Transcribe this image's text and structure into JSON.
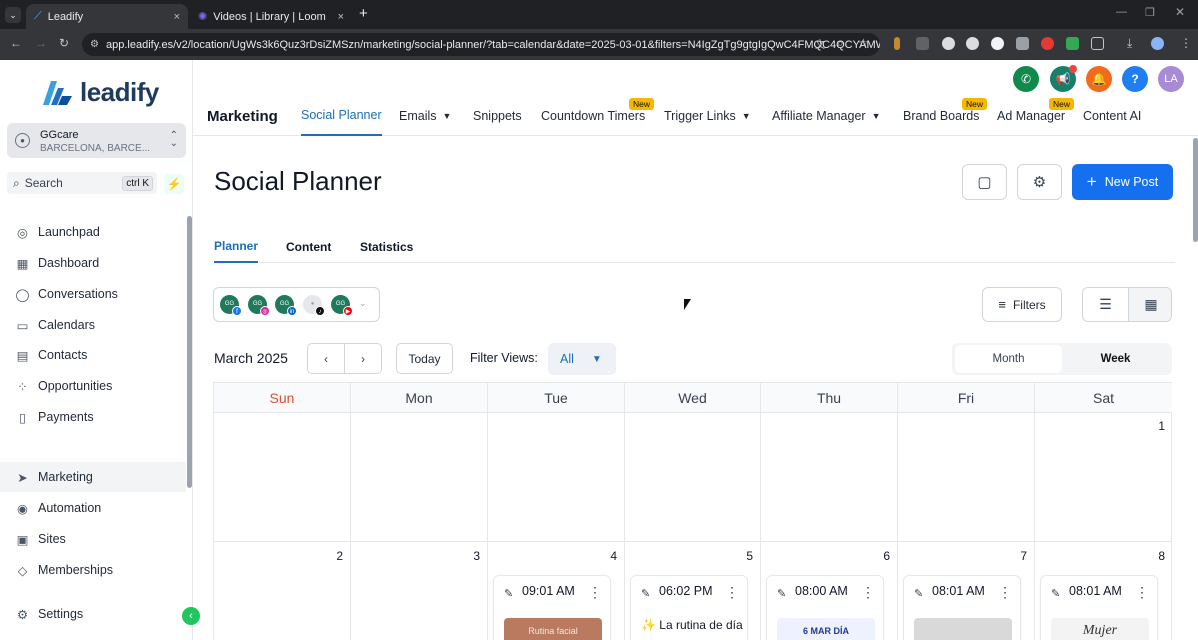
{
  "browser": {
    "tabs": [
      {
        "title": "Leadify",
        "close": "×"
      },
      {
        "title": "Videos | Library | Loom",
        "close": "×"
      }
    ],
    "new_tab": "+",
    "url": "app.leadify.es/v2/location/UgWs3k6Quz3rDsiZMSzn/marketing/social-planner/?tab=calendar&date=2025-03-01&filters=N4IgZgTg9gtgIgQwC4FMQC4QCYAMW..."
  },
  "sidebar": {
    "logo": "leadify",
    "account": {
      "name": "GGcare",
      "location": "BARCELONA, BARCE..."
    },
    "search": {
      "label": "Search",
      "shortcut": "ctrl K"
    },
    "items": [
      {
        "label": "Launchpad",
        "icon": "rocket-icon"
      },
      {
        "label": "Dashboard",
        "icon": "grid-icon"
      },
      {
        "label": "Conversations",
        "icon": "chat-bubble-icon"
      },
      {
        "label": "Calendars",
        "icon": "calendar-icon"
      },
      {
        "label": "Contacts",
        "icon": "contact-card-icon"
      },
      {
        "label": "Opportunities",
        "icon": "network-icon"
      },
      {
        "label": "Payments",
        "icon": "receipt-icon"
      },
      {
        "label": "Marketing",
        "icon": "paper-plane-icon",
        "active": true
      },
      {
        "label": "Automation",
        "icon": "automation-icon"
      },
      {
        "label": "Sites",
        "icon": "sites-icon"
      },
      {
        "label": "Memberships",
        "icon": "membership-icon"
      },
      {
        "label": "Settings",
        "icon": "gear-icon"
      }
    ]
  },
  "header": {
    "avatar_initials": "LA",
    "help": "?",
    "nav": [
      {
        "label": "Marketing"
      },
      {
        "label": "Social Planner",
        "active": true
      },
      {
        "label": "Emails",
        "dropdown": true
      },
      {
        "label": "Snippets"
      },
      {
        "label": "Countdown Timers",
        "badge": "New"
      },
      {
        "label": "Trigger Links",
        "dropdown": true
      },
      {
        "label": "Affiliate Manager",
        "dropdown": true
      },
      {
        "label": "Brand Boards",
        "badge": "New"
      },
      {
        "label": "Ad Manager",
        "badge": "New"
      },
      {
        "label": "Content AI"
      }
    ]
  },
  "page": {
    "title": "Social Planner",
    "new_post": "New Post",
    "tabs": [
      "Planner",
      "Content",
      "Statistics"
    ],
    "filters": "Filters",
    "month": "March 2025",
    "today": "Today",
    "filter_views_label": "Filter Views:",
    "filter_views_value": "All",
    "view_modes": [
      "Month",
      "Week"
    ]
  },
  "calendar": {
    "days": [
      "Sun",
      "Mon",
      "Tue",
      "Wed",
      "Thu",
      "Fri",
      "Sat"
    ],
    "week1": [
      "",
      "",
      "",
      "",
      "",
      "",
      "1"
    ],
    "week2": [
      "2",
      "3",
      "4",
      "5",
      "6",
      "7",
      "8"
    ],
    "posts": [
      {
        "day": "4",
        "time": "09:01 AM",
        "preview": "Rutina facial"
      },
      {
        "day": "5",
        "time": "06:02 PM",
        "caption": "✨ La rutina de día"
      },
      {
        "day": "6",
        "time": "08:00 AM",
        "preview": "6 MAR DÍA"
      },
      {
        "day": "7",
        "time": "08:01 AM",
        "preview": ""
      },
      {
        "day": "8",
        "time": "08:01 AM",
        "preview": "Mujer"
      }
    ]
  },
  "colors": {
    "accent": "#1570ef",
    "active_nav": "#1d6fb8",
    "sunday": "#e04f2b",
    "phone": "#0f8a4a",
    "megaphone": "#16806a",
    "bell": "#f26b1d",
    "help": "#1f7ff2",
    "avatar": "#a78bd4"
  }
}
